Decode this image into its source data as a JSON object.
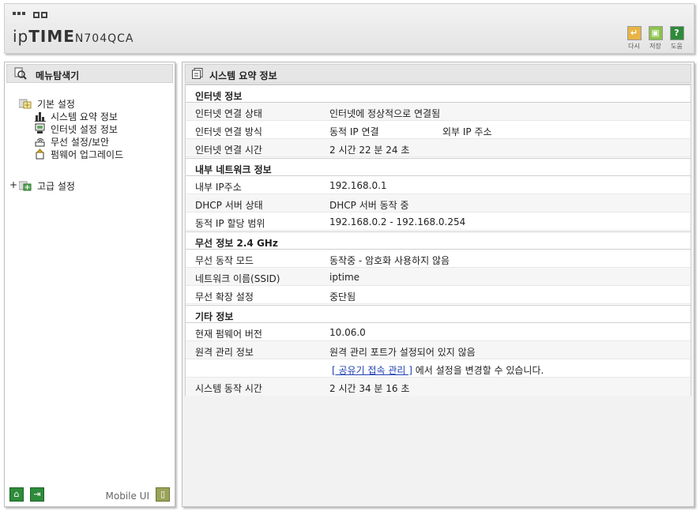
{
  "header": {
    "logo_ip": "ip",
    "logo_time": "TIME",
    "model": "N704QCA",
    "buttons": [
      {
        "label": "다시",
        "color": "#e8b445"
      },
      {
        "label": "저장",
        "color": "#8cc34b"
      },
      {
        "label": "도움",
        "color": "#2e8b3a"
      }
    ]
  },
  "sidebar": {
    "title": "메뉴탐색기",
    "tree": {
      "basic": "기본 설정",
      "items": [
        "시스템 요약 정보",
        "인터넷 설정 정보",
        "무선 설정/보안",
        "펌웨어 업그레이드"
      ],
      "advanced_expander": "+",
      "advanced": "고급 설정"
    },
    "footer": {
      "mobile_label": "Mobile UI"
    }
  },
  "main": {
    "title": "시스템 요약 정보",
    "sections": {
      "internet": "인터넷 정보",
      "lan": "내부 네트워크 정보",
      "wireless": "무선 정보 2.4 GHz",
      "etc": "기타 정보"
    },
    "rows": {
      "conn_status_label": "인터넷 연결 상태",
      "conn_status_value": "인터넷에 정상적으로 연결됨",
      "conn_type_label": "인터넷 연결 방식",
      "conn_type_value": "동적 IP 연결",
      "conn_type_extra": "외부 IP 주소",
      "conn_time_label": "인터넷 연결 시간",
      "conn_time_value": "2 시간 22 분 24 초",
      "lan_ip_label": "내부 IP주소",
      "lan_ip_value": "192.168.0.1",
      "dhcp_label": "DHCP 서버 상태",
      "dhcp_value": "DHCP 서버 동작 중",
      "range_label": "동적 IP 할당 범위",
      "range_value": "192.168.0.2 -  192.168.0.254",
      "wl_mode_label": "무선 동작 모드",
      "wl_mode_value": "동작중 - 암호화 사용하지 않음",
      "ssid_label": "네트워크 이름(SSID)",
      "ssid_value": "iptime",
      "ext_label": "무선 확장 설정",
      "ext_value": "중단됨",
      "fw_label": "현재 펌웨어 버전",
      "fw_value": "10.06.0",
      "remote_label": "원격 관리 정보",
      "remote_value": "원격 관리 포트가 설정되어 있지 않음",
      "remote_link": "[ 공유기 접속 관리 ]",
      "remote_hint": "에서 설정을 변경할 수 있습니다.",
      "uptime_label": "시스템 동작 시간",
      "uptime_value": "2 시간 34 분 16 초"
    }
  }
}
